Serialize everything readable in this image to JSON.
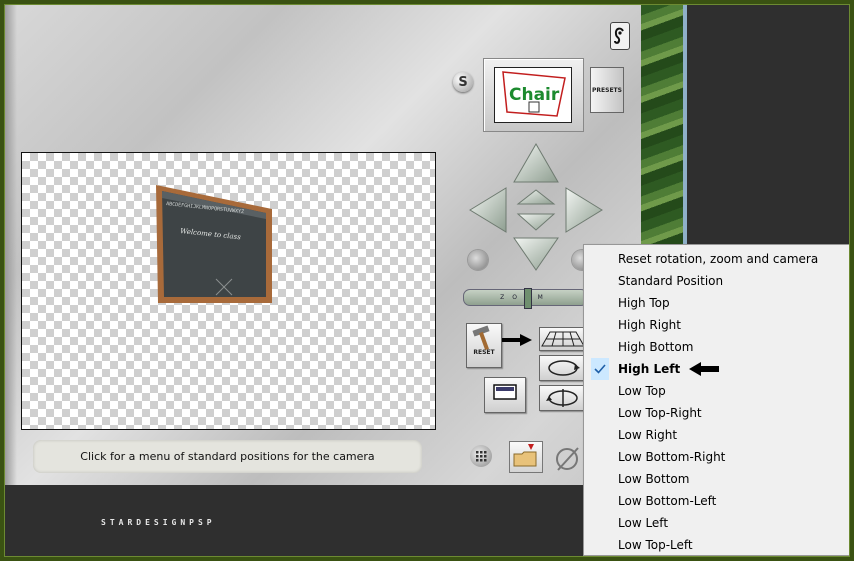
{
  "panel": {
    "status_text": "Click for a menu of standard positions for the camera",
    "presets_label": "PRESETS",
    "s_label": "S",
    "reset_label": "RESET",
    "zoom_label": "ZOOM",
    "preview_logo": "Chair"
  },
  "canvas": {
    "board_text": "Welcome to class",
    "board_alphabet": "ABCDEFGHIJKLMNOPQRSTUVWXYZ"
  },
  "watermark": "STARDESIGNPSP",
  "menu": {
    "items": [
      {
        "label": "Reset rotation, zoom and camera",
        "checked": false
      },
      {
        "label": "Standard Position",
        "checked": false
      },
      {
        "label": "High Top",
        "checked": false
      },
      {
        "label": "High Right",
        "checked": false
      },
      {
        "label": "High Bottom",
        "checked": false
      },
      {
        "label": "High Left",
        "checked": true
      },
      {
        "label": "Low Top",
        "checked": false
      },
      {
        "label": "Low Top-Right",
        "checked": false
      },
      {
        "label": "Low Right",
        "checked": false
      },
      {
        "label": "Low Bottom-Right",
        "checked": false
      },
      {
        "label": "Low Bottom",
        "checked": false
      },
      {
        "label": "Low Bottom-Left",
        "checked": false
      },
      {
        "label": "Low Left",
        "checked": false
      },
      {
        "label": "Low Top-Left",
        "checked": false
      }
    ]
  },
  "colors": {
    "frame": "#3a5212",
    "menu_bg": "#f0f0f0",
    "menu_check_bg": "#cce8ff",
    "check_mark": "#1f5fa8",
    "dark_bg": "#2f2f2f"
  }
}
